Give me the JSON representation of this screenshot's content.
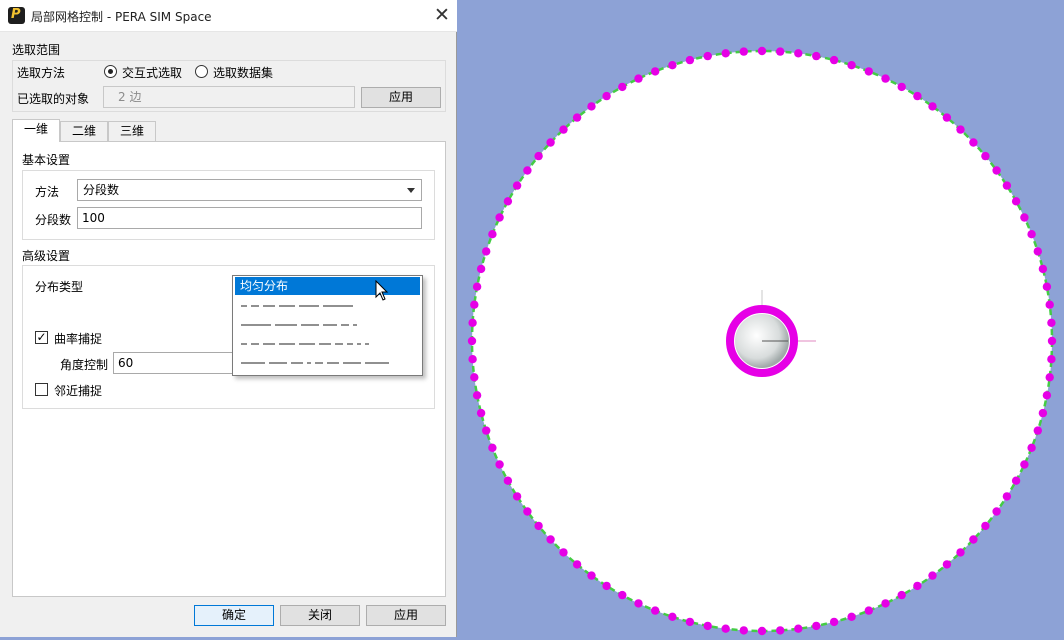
{
  "window": {
    "title": "局部网格控制 - PERA SIM Space",
    "app_icon_letter": "P"
  },
  "selection": {
    "group_label": "选取范围",
    "method_label": "选取方法",
    "option_interactive": "交互式选取",
    "option_dataset": "选取数据集",
    "selected_interactive": true,
    "selected_objects_label": "已选取的对象",
    "selected_objects_value": "2 边",
    "apply_label": "应用"
  },
  "tabs": [
    {
      "label": "一维",
      "active": true
    },
    {
      "label": "二维",
      "active": false
    },
    {
      "label": "三维",
      "active": false
    }
  ],
  "basic": {
    "group_label": "基本设置",
    "method_label": "方法",
    "method_value": "分段数",
    "segments_label": "分段数",
    "segments_value": "100"
  },
  "advanced": {
    "group_label": "高级设置",
    "distribution_label": "分布类型",
    "distribution_options": [
      "均匀分布"
    ],
    "distribution_selected": "均匀分布",
    "curvature_label": "曲率捕捉",
    "curvature_checked": true,
    "angle_label": "角度控制",
    "angle_value": "60",
    "proximity_label": "邻近捕捉",
    "proximity_checked": false
  },
  "footer": {
    "ok_label": "确定",
    "close_label": "关闭",
    "apply_label": "应用"
  },
  "viewport": {
    "background": "#8da2d6",
    "edge_color": "#44cc44",
    "node_color": "#e600e6",
    "segments": 100
  }
}
